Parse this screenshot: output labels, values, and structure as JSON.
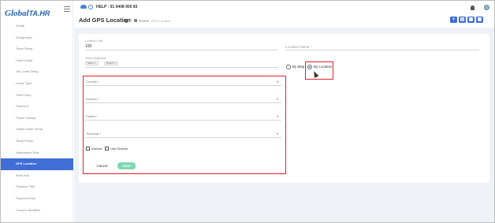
{
  "app": {
    "logo_main": "Global",
    "logo_sub": "TA.HR",
    "help_text": "HELP : 91 9408 900 83"
  },
  "sidebar": {
    "items": [
      {
        "label": "Grade"
      },
      {
        "label": "Designation"
      },
      {
        "label": "Team Setup"
      },
      {
        "label": "Label Setup"
      },
      {
        "label": "Job Code Setup"
      },
      {
        "label": "Leave Type"
      },
      {
        "label": "Shift Policy"
      },
      {
        "label": "Payment"
      },
      {
        "label": "Public Holiday"
      },
      {
        "label": "Salary Scale Setup"
      },
      {
        "label": "Swap Policy"
      },
      {
        "label": "Attendance Rule"
      },
      {
        "label": "GPS Location"
      },
      {
        "label": "Bank Info"
      },
      {
        "label": "Payment Title"
      },
      {
        "label": "Payment Rule"
      },
      {
        "label": "Custom Variables"
      }
    ],
    "active_index": 12
  },
  "header": {
    "title": "Add GPS Location",
    "breadcrumb_sep": "|",
    "breadcrumb_home": "Home",
    "breadcrumb_sep2": "/",
    "breadcrumb_current": "GPS Location",
    "action_buttons": [
      "+",
      "▤",
      "▦",
      "▣"
    ]
  },
  "form": {
    "location_code_label": "Location Code",
    "location_code_value": "100",
    "applicable_for_label": "Select Applicable",
    "chips": [
      "Admin ×",
      "Branch ×"
    ],
    "location_name_label": "Location Name *",
    "radio_by_map": "By Map",
    "radio_by_location": "By Location",
    "selected_mode": "By Location",
    "country_label": "Country *",
    "division_label": "Division *",
    "district_label": "District *",
    "township_label": "Township *",
    "inactive_label": "Inactive",
    "use_division_label": "Use Division",
    "cancel_label": "Cancel",
    "save_label": "Save"
  },
  "colors": {
    "accent": "#3f6ed6",
    "save": "#7fd8b3",
    "highlight": "#e0232b"
  }
}
